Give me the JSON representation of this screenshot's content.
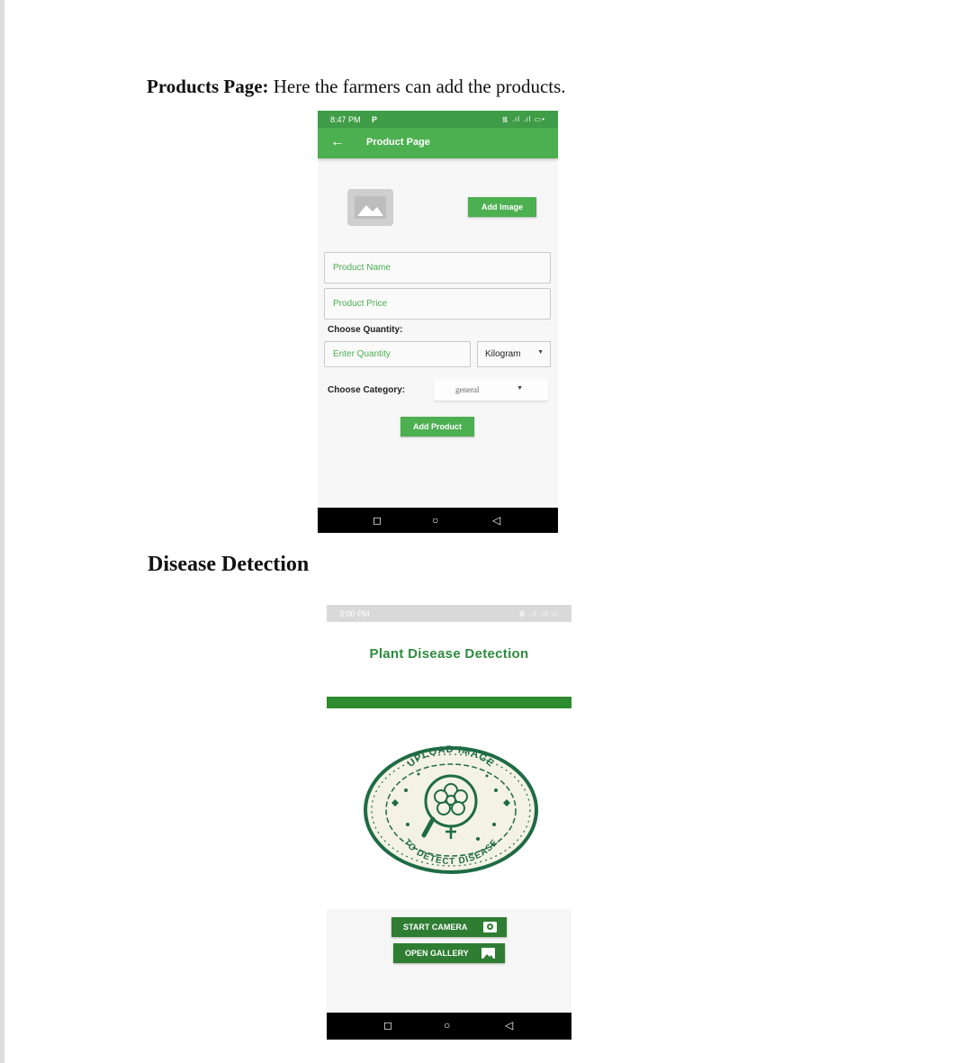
{
  "document": {
    "products_caption_bold": "Products Page:",
    "products_caption_rest": " Here the farmers can add the products.",
    "disease_heading": "Disease Detection"
  },
  "product_screen": {
    "status_time": "8:47 PM",
    "status_pin": "P",
    "status_icons": "᯾ .ıl .ıl ▭•",
    "appbar_back": "←",
    "appbar_title": "Product Page",
    "add_image_label": "Add Image",
    "product_name_placeholder": "Product Name",
    "product_price_placeholder": "Product Price",
    "choose_quantity_label": "Choose Quantity:",
    "quantity_placeholder": "Enter Quantity",
    "unit_selected": "Kilogram",
    "choose_category_label": "Choose Category:",
    "category_selected": "general",
    "add_product_label": "Add Product",
    "nav_square": "◻",
    "nav_circle": "○",
    "nav_back": "◁"
  },
  "disease_screen": {
    "status_time": "3:00 PM",
    "status_icons": "᯾ .ıl .ıl ▭",
    "title": "Plant Disease Detection",
    "logo_text_top": "UPLOAD IMAGE",
    "logo_text_bottom": "TO DETECT DISEASE",
    "start_camera_label": "START CAMERA",
    "open_gallery_label": "OPEN GALLERY",
    "nav_square": "◻",
    "nav_circle": "○",
    "nav_back": "◁"
  },
  "colors": {
    "appbar_green": "#4caf50",
    "status_green": "#3f9c47",
    "title_green": "#2e8b3e",
    "button_dark_green": "#2e7d32",
    "logo_green": "#1e6b45",
    "logo_cream": "#f4f2e4"
  }
}
